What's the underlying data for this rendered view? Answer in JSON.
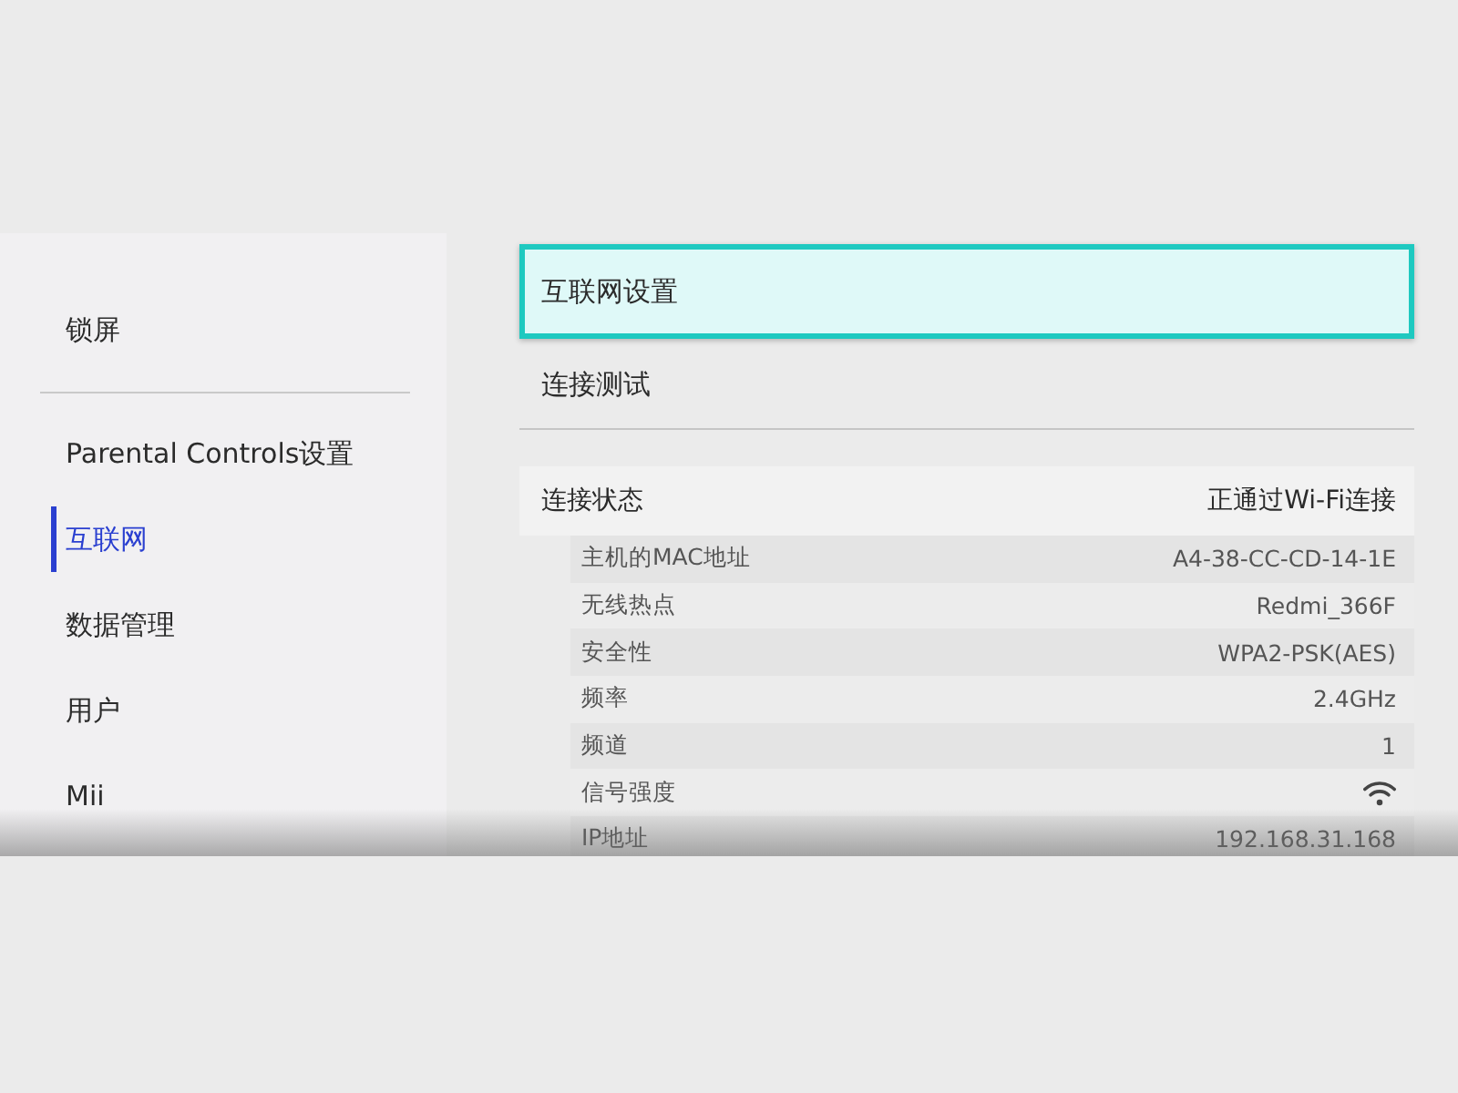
{
  "sidebar": {
    "groups": [
      {
        "items": [
          {
            "label": "锁屏",
            "selected": false
          }
        ]
      },
      {
        "items": [
          {
            "label": "Parental Controls设置",
            "selected": false
          },
          {
            "label": "互联网",
            "selected": true
          },
          {
            "label": "数据管理",
            "selected": false
          },
          {
            "label": "用户",
            "selected": false
          },
          {
            "label": "Mii",
            "selected": false
          }
        ]
      }
    ]
  },
  "menu": [
    {
      "label": "互联网设置",
      "selected": true
    },
    {
      "label": "连接测试",
      "selected": false
    }
  ],
  "status": {
    "label": "连接状态",
    "value": "正通过Wi-Fi连接"
  },
  "details": [
    {
      "kind": "text",
      "label": "主机的MAC地址",
      "value": "A4-38-CC-CD-14-1E"
    },
    {
      "kind": "text",
      "label": "无线热点",
      "value": "Redmi_366F"
    },
    {
      "kind": "text",
      "label": "安全性",
      "value": "WPA2-PSK(AES)"
    },
    {
      "kind": "text",
      "label": "频率",
      "value": "2.4GHz"
    },
    {
      "kind": "text",
      "label": "频道",
      "value": "1"
    },
    {
      "kind": "signal",
      "label": "信号强度"
    },
    {
      "kind": "text",
      "label": "IP地址",
      "value": "192.168.31.168"
    }
  ]
}
